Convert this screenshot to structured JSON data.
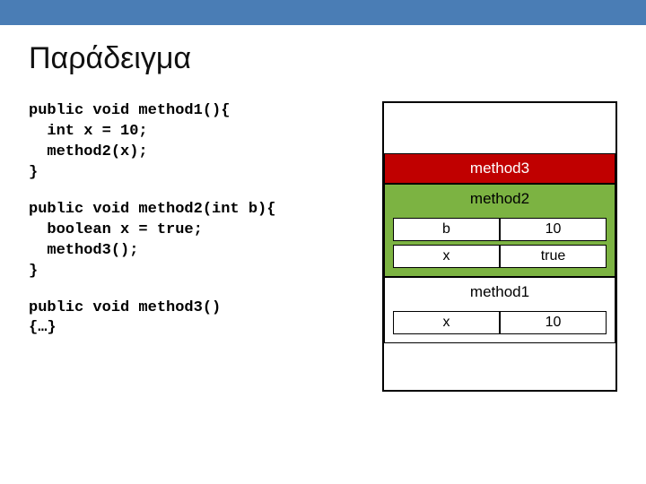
{
  "title": "Παράδειγμα",
  "code": {
    "m1": "public void method1(){\n  int x = 10;\n  method2(x);\n}",
    "m2": "public void method2(int b){\n  boolean x = true;\n  method3();\n}",
    "m3": "public void method3()\n{…}"
  },
  "stack": {
    "f3": {
      "label": "method3"
    },
    "f2": {
      "label": "method2",
      "vars": [
        {
          "name": "b",
          "val": "10"
        },
        {
          "name": "x",
          "val": "true"
        }
      ]
    },
    "f1": {
      "label": "method1",
      "vars": [
        {
          "name": "x",
          "val": "10"
        }
      ]
    }
  }
}
